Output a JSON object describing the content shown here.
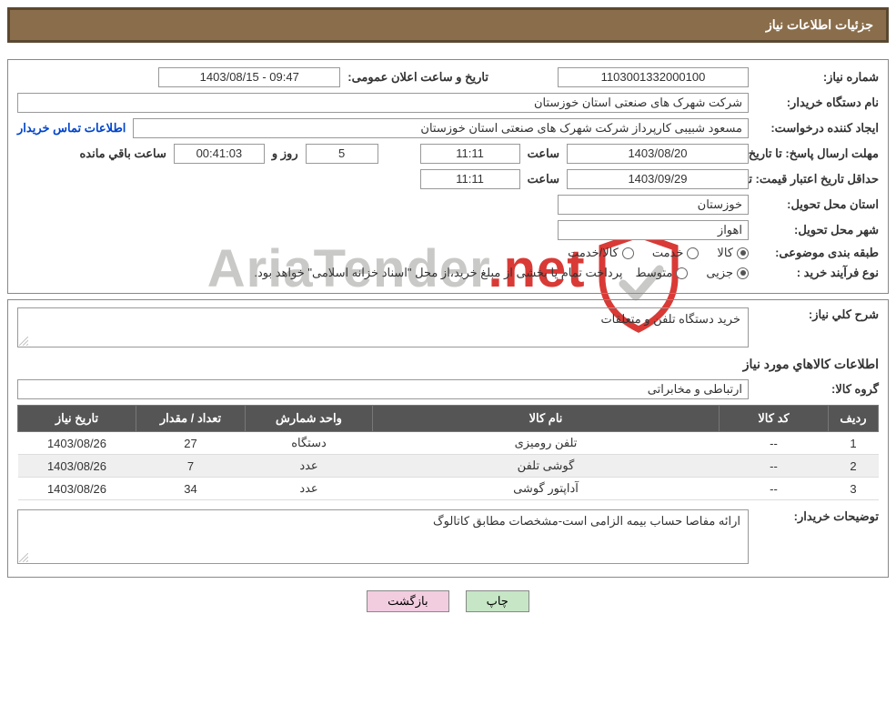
{
  "header": {
    "title": "جزئیات اطلاعات نیاز"
  },
  "need_number": {
    "label": "شماره نیاز:",
    "value": "1103001332000100"
  },
  "announce": {
    "label": "تاریخ و ساعت اعلان عمومی:",
    "value": "1403/08/15 - 09:47"
  },
  "buyer_org": {
    "label": "نام دستگاه خریدار:",
    "value": "شرکت شهرک های صنعتی استان خوزستان"
  },
  "requester": {
    "label": "ایجاد کننده درخواست:",
    "value": "مسعود شبیبی کارپرداز شرکت شهرک های صنعتی استان خوزستان"
  },
  "contact_link": "اطلاعات تماس خریدار",
  "deadline": {
    "label": "مهلت ارسال پاسخ: تا تاریخ:",
    "date": "1403/08/20",
    "time_label": "ساعت",
    "time": "11:11",
    "days": "5",
    "days_label": "روز و",
    "countdown": "00:41:03",
    "remain_label": "ساعت باقي مانده"
  },
  "validity": {
    "label": "حداقل تاریخ اعتبار قیمت: تا تاریخ:",
    "date": "1403/09/29",
    "time_label": "ساعت",
    "time": "11:11"
  },
  "delivery_province": {
    "label": "استان محل تحویل:",
    "value": "خوزستان"
  },
  "delivery_city": {
    "label": "شهر محل تحویل:",
    "value": "اهواز"
  },
  "classification": {
    "label": "طبقه بندی موضوعی:",
    "opt_goods": "کالا",
    "opt_service": "خدمت",
    "opt_both": "کالا/خدمت"
  },
  "process": {
    "label": "نوع فرآیند خرید :",
    "opt_partial": "جزیی",
    "opt_medium": "متوسط",
    "note": "پرداخت تمام یا بخشی از مبلغ خرید،از محل \"اسناد خزانه اسلامی\" خواهد بود."
  },
  "summary": {
    "label": "شرح کلي نياز:",
    "text": "خرید دستگاه تلفن و متعلقات"
  },
  "goods_title": "اطلاعات کالاهاي مورد نياز",
  "group": {
    "label": "گروه کالا:",
    "value": "ارتباطی و مخابراتی"
  },
  "table": {
    "headers": {
      "row": "ردیف",
      "code": "کد کالا",
      "name": "نام کالا",
      "unit": "واحد شمارش",
      "qty": "تعداد / مقدار",
      "date": "تاریخ نیاز"
    },
    "rows": [
      {
        "n": "1",
        "code": "--",
        "name": "تلفن رومیزی",
        "unit": "دستگاه",
        "qty": "27",
        "date": "1403/08/26"
      },
      {
        "n": "2",
        "code": "--",
        "name": "گوشی تلفن",
        "unit": "عدد",
        "qty": "7",
        "date": "1403/08/26"
      },
      {
        "n": "3",
        "code": "--",
        "name": "آداپتور گوشی",
        "unit": "عدد",
        "qty": "34",
        "date": "1403/08/26"
      }
    ]
  },
  "buyer_notes": {
    "label": "توضيحات خریدار:",
    "text": "ارائه مفاصا حساب بیمه الزامی است-مشخصات مطابق کاتالوگ"
  },
  "buttons": {
    "print": "چاپ",
    "back": "بازگشت"
  },
  "watermark": {
    "part1": "AriaTender",
    "part2": ".net"
  }
}
